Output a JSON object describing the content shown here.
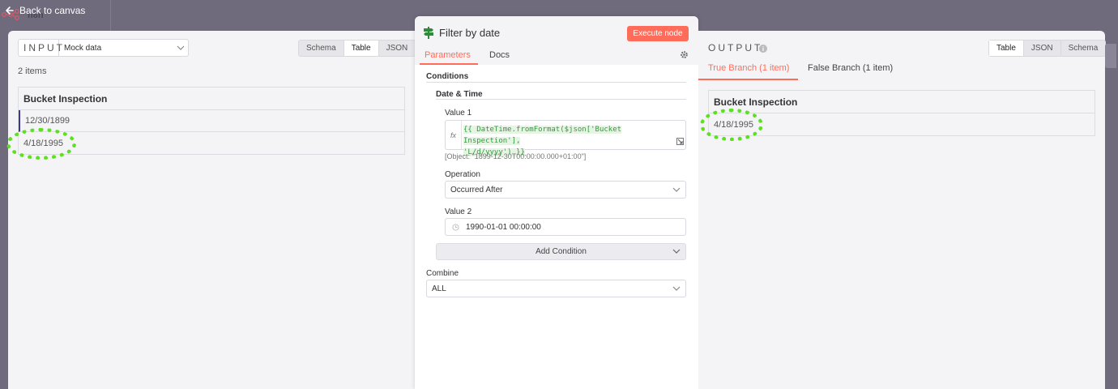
{
  "app": {
    "logo_text": "n8n",
    "back_label": "Back to canvas"
  },
  "input": {
    "label": "INPUT",
    "source_select": "Mock data",
    "view_tabs": [
      "Schema",
      "Table",
      "JSON"
    ],
    "active_view": "Table",
    "item_count": "2 items",
    "column": "Bucket Inspection",
    "rows": [
      "12/30/1899",
      "4/18/1995"
    ]
  },
  "node": {
    "title": "Filter by date",
    "execute_label": "Execute node",
    "tabs": [
      "Parameters",
      "Docs"
    ],
    "active_tab": "Parameters",
    "conditions_label": "Conditions",
    "group_label": "Date & Time",
    "value1_label": "Value 1",
    "fx_label": "fx",
    "expression_line1": "{{ DateTime.fromFormat($json['Bucket Inspection'],",
    "expression_line2": "'L/d/yyyy') }}",
    "expression_hint": "[Object: \"1899-12-30T00:00:00.000+01:00\"]",
    "operation_label": "Operation",
    "operation_value": "Occurred After",
    "value2_label": "Value 2",
    "value2_value": "1990-01-01 00:00:00",
    "add_condition_label": "Add Condition",
    "combine_label": "Combine",
    "combine_value": "ALL"
  },
  "output": {
    "label": "OUTPUT",
    "view_tabs": [
      "Table",
      "JSON",
      "Schema"
    ],
    "active_view": "Table",
    "branches": [
      "True Branch (1 item)",
      "False Branch (1 item)"
    ],
    "active_branch": "True Branch (1 item)",
    "column": "Bucket Inspection",
    "rows": [
      "4/18/1995"
    ]
  },
  "colors": {
    "accent": "#ff6d5a",
    "highlight": "#5ce01f",
    "background": "#6f6b7d",
    "panel": "#f4f4f6"
  }
}
